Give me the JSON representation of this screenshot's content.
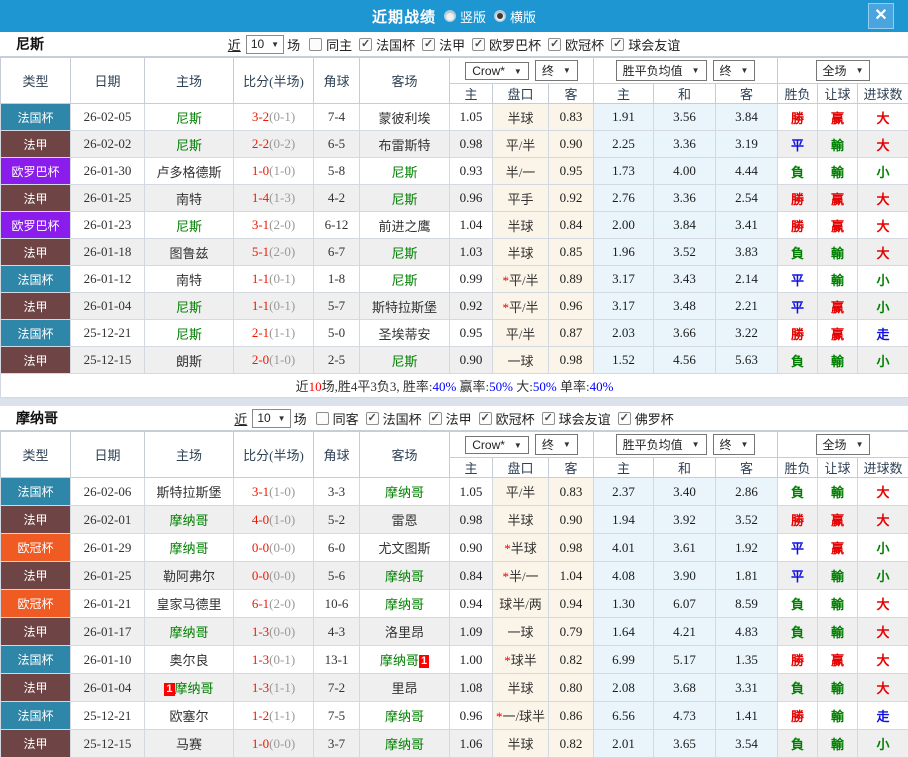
{
  "titlebar": {
    "title": "近期战绩",
    "vertical_label": "竖版",
    "horizontal_label": "横版",
    "selected_layout": "横版",
    "close_label": "✕",
    "bar_color": "#1E96D2"
  },
  "headers": {
    "cols": [
      "类型",
      "日期",
      "主场",
      "比分(半场)",
      "角球",
      "客场"
    ],
    "crown_dd": "Crow*",
    "final_dd": "终",
    "avg_dd": "胜平负均值",
    "full_dd": "全场",
    "sub": [
      "主",
      "盘口",
      "客",
      "主",
      "和",
      "客",
      "胜负",
      "让球",
      "进球数"
    ]
  },
  "type_colors": {
    "法国杯": "#2E86A8",
    "法甲": "#6F4444",
    "欧罗巴杯": "#8A1CEC",
    "欧冠杯": "#F05A23"
  },
  "outcome_colors": {
    "勝": "#E60000",
    "負": "#008000",
    "平": "#1010E0",
    "赢": "#E60000",
    "輸": "#008000",
    "走": "#1010E0",
    "大": "#E60000",
    "小": "#008000"
  },
  "sections": [
    {
      "team": "尼斯",
      "filter": {
        "near": "近",
        "count": "10",
        "games_label": "场",
        "same_label": "同主",
        "same_checked": false,
        "cups": [
          "法国杯",
          "法甲",
          "欧罗巴杯",
          "欧冠杯",
          "球会友谊"
        ]
      },
      "rows": [
        {
          "type": "法国杯",
          "date": "26-02-05",
          "home": "尼斯",
          "home_team": true,
          "score": "3-2",
          "half": "(0-1)",
          "corner": "7-4",
          "away": "蒙彼利埃",
          "away_team": false,
          "o1": "1.05",
          "pan": "半球",
          "o2": "0.83",
          "a1": "1.91",
          "a2": "3.56",
          "a3": "3.84",
          "r": "勝",
          "hr": "赢",
          "g": "大"
        },
        {
          "type": "法甲",
          "date": "26-02-02",
          "home": "尼斯",
          "home_team": true,
          "score": "2-2",
          "half": "(0-2)",
          "corner": "6-5",
          "away": "布雷斯特",
          "away_team": false,
          "o1": "0.98",
          "pan": "平/半",
          "o2": "0.90",
          "a1": "2.25",
          "a2": "3.36",
          "a3": "3.19",
          "r": "平",
          "hr": "輸",
          "g": "大"
        },
        {
          "type": "欧罗巴杯",
          "date": "26-01-30",
          "home": "卢多格德斯",
          "home_team": false,
          "score": "1-0",
          "half": "(1-0)",
          "corner": "5-8",
          "away": "尼斯",
          "away_team": true,
          "o1": "0.93",
          "pan": "半/一",
          "o2": "0.95",
          "a1": "1.73",
          "a2": "4.00",
          "a3": "4.44",
          "r": "負",
          "hr": "輸",
          "g": "小"
        },
        {
          "type": "法甲",
          "date": "26-01-25",
          "home": "南特",
          "home_team": false,
          "score": "1-4",
          "half": "(1-3)",
          "corner": "4-2",
          "away": "尼斯",
          "away_team": true,
          "o1": "0.96",
          "pan": "平手",
          "o2": "0.92",
          "a1": "2.76",
          "a2": "3.36",
          "a3": "2.54",
          "r": "勝",
          "hr": "赢",
          "g": "大"
        },
        {
          "type": "欧罗巴杯",
          "date": "26-01-23",
          "home": "尼斯",
          "home_team": true,
          "score": "3-1",
          "half": "(2-0)",
          "corner": "6-12",
          "away": "前进之鹰",
          "away_team": false,
          "o1": "1.04",
          "pan": "半球",
          "o2": "0.84",
          "a1": "2.00",
          "a2": "3.84",
          "a3": "3.41",
          "r": "勝",
          "hr": "赢",
          "g": "大"
        },
        {
          "type": "法甲",
          "date": "26-01-18",
          "home": "图鲁兹",
          "home_team": false,
          "score": "5-1",
          "half": "(2-0)",
          "corner": "6-7",
          "away": "尼斯",
          "away_team": true,
          "o1": "1.03",
          "pan": "半球",
          "o2": "0.85",
          "a1": "1.96",
          "a2": "3.52",
          "a3": "3.83",
          "r": "負",
          "hr": "輸",
          "g": "大"
        },
        {
          "type": "法国杯",
          "date": "26-01-12",
          "home": "南特",
          "home_team": false,
          "score": "1-1",
          "half": "(0-1)",
          "corner": "1-8",
          "away": "尼斯",
          "away_team": true,
          "o1": "0.99",
          "pan": "*平/半",
          "o2": "0.89",
          "a1": "3.17",
          "a2": "3.43",
          "a3": "2.14",
          "r": "平",
          "hr": "輸",
          "g": "小"
        },
        {
          "type": "法甲",
          "date": "26-01-04",
          "home": "尼斯",
          "home_team": true,
          "score": "1-1",
          "half": "(0-1)",
          "corner": "5-7",
          "away": "斯特拉斯堡",
          "away_team": false,
          "o1": "0.92",
          "pan": "*平/半",
          "o2": "0.96",
          "a1": "3.17",
          "a2": "3.48",
          "a3": "2.21",
          "r": "平",
          "hr": "赢",
          "g": "小"
        },
        {
          "type": "法国杯",
          "date": "25-12-21",
          "home": "尼斯",
          "home_team": true,
          "score": "2-1",
          "half": "(1-1)",
          "corner": "5-0",
          "away": "圣埃蒂安",
          "away_team": false,
          "o1": "0.95",
          "pan": "平/半",
          "o2": "0.87",
          "a1": "2.03",
          "a2": "3.66",
          "a3": "3.22",
          "r": "勝",
          "hr": "赢",
          "g": "走"
        },
        {
          "type": "法甲",
          "date": "25-12-15",
          "home": "朗斯",
          "home_team": false,
          "score": "2-0",
          "half": "(1-0)",
          "corner": "2-5",
          "away": "尼斯",
          "away_team": true,
          "o1": "0.90",
          "pan": "一球",
          "o2": "0.98",
          "a1": "1.52",
          "a2": "4.56",
          "a3": "5.63",
          "r": "負",
          "hr": "輸",
          "g": "小"
        }
      ],
      "summary": [
        {
          "t": "近",
          "c": "#333333"
        },
        {
          "t": "10",
          "c": "#FF0000"
        },
        {
          "t": "场,胜4平3负3, 胜率:",
          "c": "#333333"
        },
        {
          "t": "40%",
          "c": "#0000FF"
        },
        {
          "t": " 赢率:",
          "c": "#333333"
        },
        {
          "t": "50%",
          "c": "#0000FF"
        },
        {
          "t": " 大:",
          "c": "#333333"
        },
        {
          "t": "50%",
          "c": "#0000FF"
        },
        {
          "t": " 单率:",
          "c": "#333333"
        },
        {
          "t": "40%",
          "c": "#0000FF"
        }
      ]
    },
    {
      "team": "摩纳哥",
      "filter": {
        "near": "近",
        "count": "10",
        "games_label": "场",
        "same_label": "同客",
        "same_checked": false,
        "cups": [
          "法国杯",
          "法甲",
          "欧冠杯",
          "球会友谊",
          "佛罗杯"
        ]
      },
      "rows": [
        {
          "type": "法国杯",
          "date": "26-02-06",
          "home": "斯特拉斯堡",
          "home_team": false,
          "score": "3-1",
          "half": "(1-0)",
          "corner": "3-3",
          "away": "摩纳哥",
          "away_team": true,
          "o1": "1.05",
          "pan": "平/半",
          "o2": "0.83",
          "a1": "2.37",
          "a2": "3.40",
          "a3": "2.86",
          "r": "負",
          "hr": "輸",
          "g": "大"
        },
        {
          "type": "法甲",
          "date": "26-02-01",
          "home": "摩纳哥",
          "home_team": true,
          "score": "4-0",
          "half": "(1-0)",
          "corner": "5-2",
          "away": "雷恩",
          "away_team": false,
          "o1": "0.98",
          "pan": "半球",
          "o2": "0.90",
          "a1": "1.94",
          "a2": "3.92",
          "a3": "3.52",
          "r": "勝",
          "hr": "赢",
          "g": "大"
        },
        {
          "type": "欧冠杯",
          "date": "26-01-29",
          "home": "摩纳哥",
          "home_team": true,
          "score": "0-0",
          "half": "(0-0)",
          "corner": "6-0",
          "away": "尤文图斯",
          "away_team": false,
          "o1": "0.90",
          "pan": "*半球",
          "o2": "0.98",
          "a1": "4.01",
          "a2": "3.61",
          "a3": "1.92",
          "r": "平",
          "hr": "赢",
          "g": "小"
        },
        {
          "type": "法甲",
          "date": "26-01-25",
          "home": "勒阿弗尔",
          "home_team": false,
          "score": "0-0",
          "half": "(0-0)",
          "corner": "5-6",
          "away": "摩纳哥",
          "away_team": true,
          "o1": "0.84",
          "pan": "*半/一",
          "o2": "1.04",
          "a1": "4.08",
          "a2": "3.90",
          "a3": "1.81",
          "r": "平",
          "hr": "輸",
          "g": "小"
        },
        {
          "type": "欧冠杯",
          "date": "26-01-21",
          "home": "皇家马德里",
          "home_team": false,
          "score": "6-1",
          "half": "(2-0)",
          "corner": "10-6",
          "away": "摩纳哥",
          "away_team": true,
          "o1": "0.94",
          "pan": "球半/两",
          "o2": "0.94",
          "a1": "1.30",
          "a2": "6.07",
          "a3": "8.59",
          "r": "負",
          "hr": "輸",
          "g": "大"
        },
        {
          "type": "法甲",
          "date": "26-01-17",
          "home": "摩纳哥",
          "home_team": true,
          "score": "1-3",
          "half": "(0-0)",
          "corner": "4-3",
          "away": "洛里昂",
          "away_team": false,
          "o1": "1.09",
          "pan": "一球",
          "o2": "0.79",
          "a1": "1.64",
          "a2": "4.21",
          "a3": "4.83",
          "r": "負",
          "hr": "輸",
          "g": "大"
        },
        {
          "type": "法国杯",
          "date": "26-01-10",
          "home": "奥尔良",
          "home_team": false,
          "score": "1-3",
          "half": "(0-1)",
          "corner": "13-1",
          "away": "摩纳哥",
          "away_team": true,
          "away_rc_after": "1",
          "o1": "1.00",
          "pan": "*球半",
          "o2": "0.82",
          "a1": "6.99",
          "a2": "5.17",
          "a3": "1.35",
          "r": "勝",
          "hr": "赢",
          "g": "大"
        },
        {
          "type": "法甲",
          "date": "26-01-04",
          "home": "摩纳哥",
          "home_team": true,
          "home_rc_before": "1",
          "score": "1-3",
          "half": "(1-1)",
          "corner": "7-2",
          "away": "里昂",
          "away_team": false,
          "o1": "1.08",
          "pan": "半球",
          "o2": "0.80",
          "a1": "2.08",
          "a2": "3.68",
          "a3": "3.31",
          "r": "負",
          "hr": "輸",
          "g": "大"
        },
        {
          "type": "法国杯",
          "date": "25-12-21",
          "home": "欧塞尔",
          "home_team": false,
          "score": "1-2",
          "half": "(1-1)",
          "corner": "7-5",
          "away": "摩纳哥",
          "away_team": true,
          "o1": "0.96",
          "pan": "*一/球半",
          "o2": "0.86",
          "a1": "6.56",
          "a2": "4.73",
          "a3": "1.41",
          "r": "勝",
          "hr": "輸",
          "g": "走"
        },
        {
          "type": "法甲",
          "date": "25-12-15",
          "home": "马赛",
          "home_team": false,
          "score": "1-0",
          "half": "(0-0)",
          "corner": "3-7",
          "away": "摩纳哥",
          "away_team": true,
          "o1": "1.06",
          "pan": "半球",
          "o2": "0.82",
          "a1": "2.01",
          "a2": "3.65",
          "a3": "3.54",
          "r": "負",
          "hr": "輸",
          "g": "小"
        }
      ],
      "summary": null
    }
  ]
}
